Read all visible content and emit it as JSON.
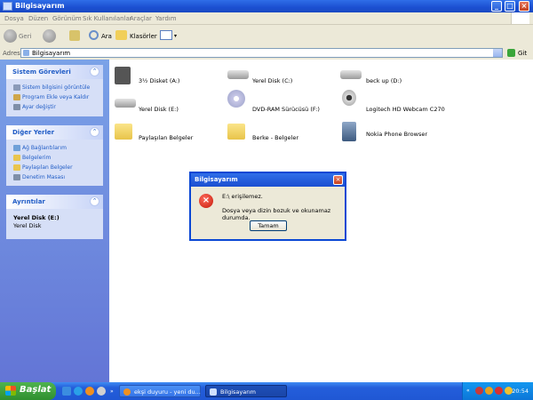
{
  "window": {
    "title": "Bilgisayarım"
  },
  "menu": [
    "Dosya",
    "Düzen",
    "Görünüm",
    "Sık Kullanılanlar",
    "Araçlar",
    "Yardım"
  ],
  "toolbar": {
    "back": "Geri",
    "search": "Ara",
    "folders": "Klasörler"
  },
  "address": {
    "label": "Adres",
    "value": "Bilgisayarım",
    "go": "Git"
  },
  "panels": {
    "system": {
      "title": "Sistem Görevleri",
      "items": [
        "Sistem bilgisini görüntüle",
        "Program Ekle veya Kaldır",
        "Ayar değiştir"
      ]
    },
    "other": {
      "title": "Diğer Yerler",
      "items": [
        "Ağ Bağlantılarım",
        "Belgelerim",
        "Paylaşılan Belgeler",
        "Denetim Masası"
      ]
    },
    "details": {
      "title": "Ayrıntılar",
      "name": "Yerel Disk (E:)",
      "type": "Yerel Disk"
    }
  },
  "items": [
    {
      "label": "3½ Disket (A:)",
      "icon": "floppy-icon"
    },
    {
      "label": "Yerel Disk (C:)",
      "icon": "hard-disk-icon"
    },
    {
      "label": "beck up (D:)",
      "icon": "hard-disk-icon"
    },
    {
      "label": "Yerel Disk (E:)",
      "icon": "hard-disk-icon"
    },
    {
      "label": "DVD-RAM Sürücüsü (F:)",
      "icon": "dvd-drive-icon"
    },
    {
      "label": "Logitech HD Webcam C270",
      "icon": "webcam-icon"
    },
    {
      "label": "Paylaşılan Belgeler",
      "icon": "folder-icon"
    },
    {
      "label": "Berke - Belgeler",
      "icon": "folder-icon"
    },
    {
      "label": "Nokia Phone Browser",
      "icon": "phone-browser-icon"
    }
  ],
  "dialog": {
    "title": "Bilgisayarım",
    "line1": "E:\\ erişilemez.",
    "line2": "Dosya veya dizin bozuk ve okunamaz durumda.",
    "ok": "Tamam"
  },
  "taskbar": {
    "start": "Başlat",
    "buttons": [
      "ekşi duyuru - yeni du...",
      "Bilgisayarım"
    ],
    "clock": "20:54"
  },
  "colors": {
    "accent": "#0a47d4",
    "taskbar": "#245edb",
    "start": "#3c9c3c",
    "error": "#d42a1a"
  }
}
